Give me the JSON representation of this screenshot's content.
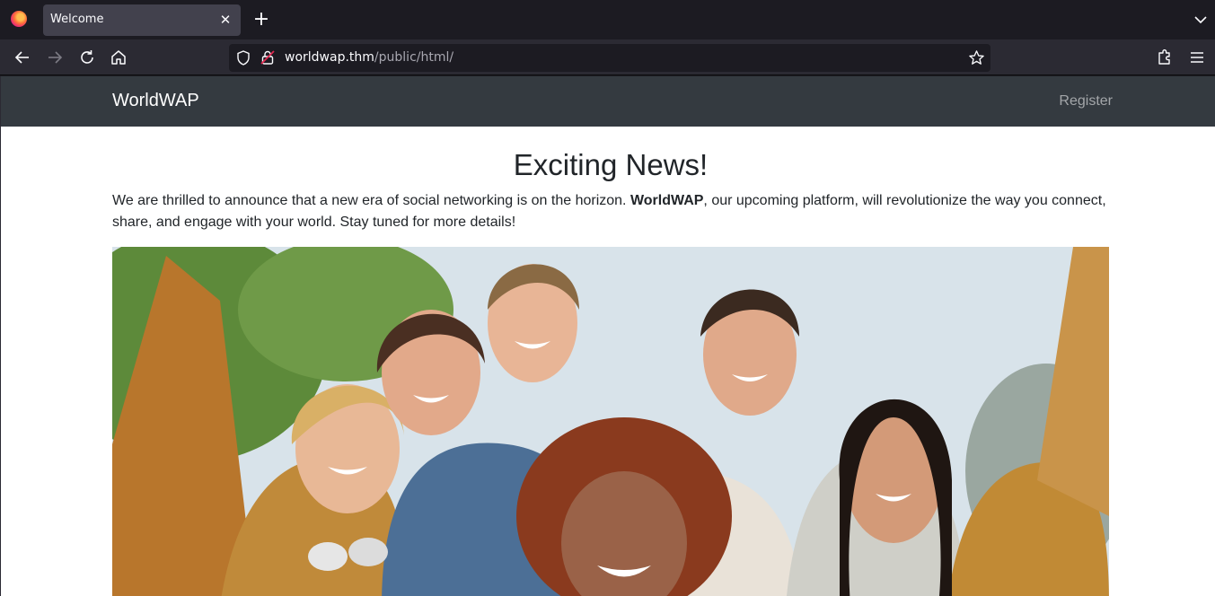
{
  "browser": {
    "tab_title": "Welcome",
    "url_host": "worldwap.thm",
    "url_path": "/public/html/"
  },
  "site": {
    "brand": "WorldWAP",
    "nav_register": "Register"
  },
  "content": {
    "heading": "Exciting News!",
    "intro_before": "We are thrilled to announce that a new era of social networking is on the horizon. ",
    "intro_bold": "WorldWAP",
    "intro_after": ", our upcoming platform, will revolutionize the way you connect, share, and engage with your world. Stay tuned for more details!"
  },
  "colors": {
    "site_nav_bg": "#343a40",
    "browser_bg": "#1c1b22"
  }
}
